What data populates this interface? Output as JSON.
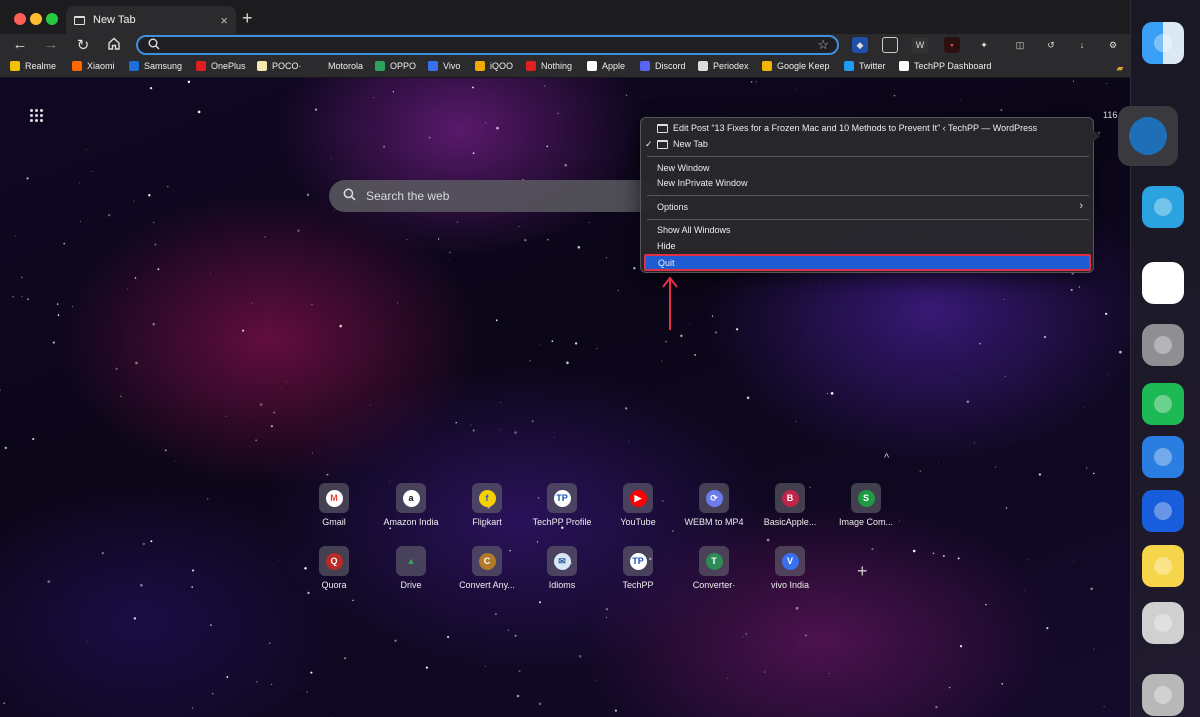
{
  "browser": {
    "tab_title": "New Tab",
    "close_glyph": "×",
    "new_tab_glyph": "+",
    "page_indicator": "116"
  },
  "bookmarks": [
    {
      "label": "Realme",
      "color": "#f2c200"
    },
    {
      "label": "Xiaomi",
      "color": "#ff6900"
    },
    {
      "label": "Samsung",
      "color": "#1c6fd8"
    },
    {
      "label": "OnePlus",
      "color": "#e02020"
    },
    {
      "label": "POCO·",
      "color": "#f5e9b0"
    },
    {
      "label": "Motorola",
      "color": "#2b2b2e"
    },
    {
      "label": "OPPO",
      "color": "#2aa35c"
    },
    {
      "label": "Vivo",
      "color": "#3a6ff0"
    },
    {
      "label": "iQOO",
      "color": "#f2a900"
    },
    {
      "label": "Nothing",
      "color": "#e02020"
    },
    {
      "label": "Apple",
      "color": "#ffffff"
    },
    {
      "label": "Discord",
      "color": "#5865f2"
    },
    {
      "label": "Periodex",
      "color": "#dddddd"
    },
    {
      "label": "Google Keep",
      "color": "#f5b400"
    },
    {
      "label": "Twitter",
      "color": "#1d9bf0"
    },
    {
      "label": "TechPP Dashboard",
      "color": "#ffffff"
    }
  ],
  "search": {
    "placeholder": "Search the web"
  },
  "speed_dial": [
    {
      "label": "Gmail",
      "letter": "M",
      "color": "#ea4335",
      "bg": "#ffffff"
    },
    {
      "label": "Amazon India",
      "letter": "a",
      "color": "#111111",
      "bg": "#ffffff"
    },
    {
      "label": "Flipkart",
      "letter": "f",
      "color": "#1a5fd6",
      "bg": "#f7d000"
    },
    {
      "label": "TechPP Profile",
      "letter": "TP",
      "color": "#1a4fb8",
      "bg": "#ffffff"
    },
    {
      "label": "YouTube",
      "letter": "▶",
      "color": "#ffffff",
      "bg": "#ff0000"
    },
    {
      "label": "WEBM to MP4",
      "letter": "⟳",
      "color": "#ffffff",
      "bg": "#6a7cf0"
    },
    {
      "label": "BasicApple...",
      "letter": "B",
      "color": "#ffffff",
      "bg": "#c0264a"
    },
    {
      "label": "Image Com...",
      "letter": "S",
      "color": "#ffffff",
      "bg": "#1f9a44"
    },
    {
      "label": "Quora",
      "letter": "Q",
      "color": "#ffffff",
      "bg": "#b92b27"
    },
    {
      "label": "Drive",
      "letter": "▲",
      "color": "#34a853",
      "bg": "transparent"
    },
    {
      "label": "Convert Any...",
      "letter": "C",
      "color": "#ffffff",
      "bg": "#b07a2a"
    },
    {
      "label": "Idioms",
      "letter": "✉",
      "color": "#2a5c9a",
      "bg": "#d8e6f5"
    },
    {
      "label": "TechPP",
      "letter": "TP",
      "color": "#1a4fb8",
      "bg": "#ffffff"
    },
    {
      "label": "Converter·",
      "letter": "T",
      "color": "#ffffff",
      "bg": "#2e8b57"
    },
    {
      "label": "vivo India",
      "letter": "V",
      "color": "#ffffff",
      "bg": "#3a6ff0"
    }
  ],
  "context_menu": {
    "windows": [
      "Edit Post “13 Fixes for a Frozen Mac and 10 Methods to Prevent It” ‹ TechPP — WordPress",
      "New Tab"
    ],
    "checkmark": "✓",
    "new_window": "New Window",
    "new_private_window": "New InPrivate Window",
    "options": "Options",
    "show_all_windows": "Show All Windows",
    "hide": "Hide",
    "quit": "Quit"
  },
  "dock": [
    {
      "name": "finder-icon",
      "color": "#3aa0f5"
    },
    {
      "name": "edge-icon",
      "color": "#1e6fb8"
    },
    {
      "name": "telegram-icon",
      "color": "#2aa3e0"
    },
    {
      "name": "slack-icon",
      "color": "#ffffff"
    },
    {
      "name": "system-settings-icon",
      "color": "#8e8e93"
    },
    {
      "name": "spotify-icon",
      "color": "#1db954"
    },
    {
      "name": "tasks-icon",
      "color": "#2a7de1"
    },
    {
      "name": "bitwarden-icon",
      "color": "#175ddc"
    },
    {
      "name": "notes-icon",
      "color": "#f7d54a"
    },
    {
      "name": "disk-utility-icon",
      "color": "#d0d0d0"
    },
    {
      "name": "trash-icon",
      "color": "#b8b8b8"
    }
  ]
}
